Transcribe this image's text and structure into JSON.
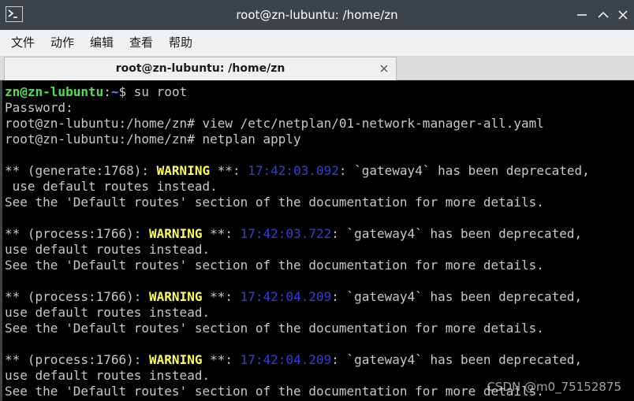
{
  "window": {
    "title": "root@zn-lubuntu: /home/zn"
  },
  "menu": [
    {
      "label": "文件"
    },
    {
      "label": "动作"
    },
    {
      "label": "编辑"
    },
    {
      "label": "查看"
    },
    {
      "label": "帮助"
    }
  ],
  "tab": {
    "label": "root@zn-lubuntu: /home/zn",
    "close_glyph": "×"
  },
  "terminal": {
    "prompt1": {
      "user": "zn@zn-lubuntu",
      "sep": ":",
      "path": "~",
      "symbol": "$ ",
      "command": "su root"
    },
    "password_line": "Password:",
    "command_lines": [
      "root@zn-lubuntu:/home/zn# view /etc/netplan/01-network-manager-all.yaml",
      "root@zn-lubuntu:/home/zn# netplan apply"
    ],
    "blocks": [
      {
        "prefix": "** (generate:1768): ",
        "warning": "WARNING",
        "mid": " **: ",
        "timestamp": "17:42:03.092",
        "message": ": `gateway4` has been deprecated,",
        "line2": " use default routes instead.",
        "line3": "See the 'Default routes' section of the documentation for more details."
      },
      {
        "prefix": "** (process:1766): ",
        "warning": "WARNING",
        "mid": " **: ",
        "timestamp": "17:42:03.722",
        "message": ": `gateway4` has been deprecated,",
        "line2": "use default routes instead.",
        "line3": "See the 'Default routes' section of the documentation for more details."
      },
      {
        "prefix": "** (process:1766): ",
        "warning": "WARNING",
        "mid": " **: ",
        "timestamp": "17:42:04.209",
        "message": ": `gateway4` has been deprecated,",
        "line2": "use default routes instead.",
        "line3": "See the 'Default routes' section of the documentation for more details."
      },
      {
        "prefix": "** (process:1766): ",
        "warning": "WARNING",
        "mid": " **: ",
        "timestamp": "17:42:04.209",
        "message": ": `gateway4` has been deprecated,",
        "line2": "use default routes instead.",
        "line3": "See the 'Default routes' section of the documentation for more details."
      }
    ]
  },
  "watermark": "CSDN @m0_75152875",
  "colors": {
    "prompt_user": "#4fe04f",
    "prompt_path": "#5c8cff",
    "warning": "#ffff54",
    "timestamp": "#2f3fd8",
    "titlebar": "#3d4449"
  },
  "icons": {
    "app": "terminal-icon",
    "minimize": "minimize-icon",
    "maximize": "maximize-icon",
    "close": "close-icon",
    "tab_close": "close-icon"
  }
}
